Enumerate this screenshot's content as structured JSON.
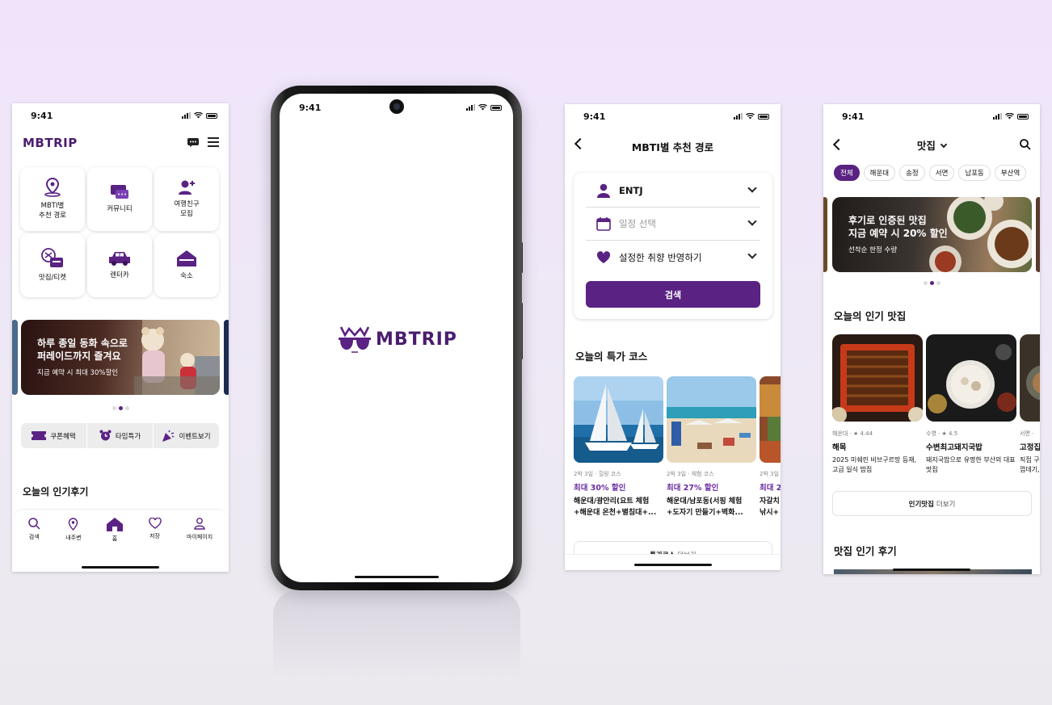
{
  "colors": {
    "brand_purple": "#5a2283",
    "background": "#efe6f7"
  },
  "screen_home": {
    "time": "9:41",
    "logo": "MBTRIP",
    "grid": [
      {
        "label": "MBTI별\n추천 경로",
        "icon": "map-pin-icon"
      },
      {
        "label": "커뮤니티",
        "icon": "chat-bubbles-icon"
      },
      {
        "label": "여행친구\n모집",
        "icon": "add-friend-icon"
      },
      {
        "label": "맛집/티켓",
        "icon": "ticket-icon"
      },
      {
        "label": "렌터카",
        "icon": "car-icon"
      },
      {
        "label": "숙소",
        "icon": "house-icon"
      }
    ],
    "banner": {
      "title": "하루 종일 동화 속으로\n퍼레이드까지 즐겨요",
      "subtitle": "지금 예약 시 최대 30%할인"
    },
    "quick": [
      {
        "label": "쿠폰혜택",
        "icon": "coupon-icon"
      },
      {
        "label": "타임특가",
        "icon": "alarm-clock-icon"
      },
      {
        "label": "이벤트보기",
        "icon": "party-popper-icon"
      }
    ],
    "popular_reviews_title": "오늘의 인기후기",
    "tabs": [
      {
        "label": "검색",
        "icon": "search-icon"
      },
      {
        "label": "내주변",
        "icon": "location-icon"
      },
      {
        "label": "홈",
        "icon": "home-icon"
      },
      {
        "label": "저장",
        "icon": "heart-icon"
      },
      {
        "label": "마이페이지",
        "icon": "person-icon"
      }
    ]
  },
  "screen_splash": {
    "time": "9:41",
    "logo": "MBTRIP"
  },
  "screen_route": {
    "time": "9:41",
    "title": "MBTI별 추천 경로",
    "mbti_value": "ENTJ",
    "date_placeholder": "일정 선택",
    "preference_label": "설정한 취향 반영하기",
    "search_label": "검색",
    "special_title": "오늘의 특가 코스",
    "courses": [
      {
        "meta": "2박 3일 · 힐링 코스",
        "discount": "최대 30% 할인",
        "name1": "해운대/광안리(요트 체험",
        "name2": "+해운대 온천+별침대+..."
      },
      {
        "meta": "2박 3일 · 체험 코스",
        "discount": "최대 27% 할인",
        "name1": "해운대/남포동(서핑 체험",
        "name2": "+도자기 만들기+벽화..."
      },
      {
        "meta": "2박 3일",
        "discount": "최대 2",
        "name1": "자갈치",
        "name2": "낚시+"
      }
    ],
    "more_bold": "특가코스",
    "more_rest": "더보기"
  },
  "screen_food": {
    "time": "9:41",
    "title": "맛집",
    "chips": [
      "전체",
      "해운대",
      "송정",
      "서면",
      "남포동",
      "부산역"
    ],
    "banner": {
      "title": "후기로 인증된 맛집\n지금 예약 시 20% 할인",
      "subtitle": "선착순 한정 수량"
    },
    "popular_title": "오늘의 인기 맛집",
    "foods": [
      {
        "area": "해운대 · ★ 4.44",
        "name": "해목",
        "desc": "2025 미쉐린 비브구르망 등재,\n고급 일식 밥집"
      },
      {
        "area": "수영 · ★ 4.5",
        "name": "수변최고돼지국밥",
        "desc": "돼지국밥으로 유명한 부산의 대표\n맛집"
      },
      {
        "area": "서면 · ",
        "name": "고정집",
        "desc": "직접 구워\n껍데기, "
      }
    ],
    "more_bold": "인기맛집",
    "more_rest": "더보기",
    "reviews_title": "맛집 인기 후기"
  }
}
